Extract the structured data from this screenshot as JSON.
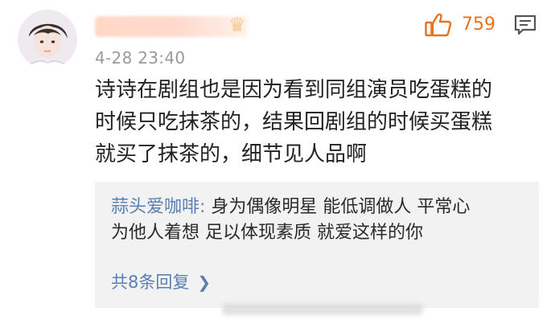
{
  "comment": {
    "timestamp": "4-28 23:40",
    "likes": "759",
    "body_lines": [
      "诗诗在剧组也是因为看到同组演员吃蛋糕的",
      "时候只吃抹茶的，结果回剧组的时候买蛋糕",
      "就买了抹茶的，细节见人品啊"
    ]
  },
  "reply": {
    "username": "蒜头爱咖啡:",
    "text_line1": " 身为偶像明星 能低调做人  平常心",
    "text_line2": "为他人着想  足以体现素质  就爱这样的你",
    "more_replies": "共8条回复"
  },
  "icons": {
    "like": "thumbs-up-icon",
    "comment": "comment-icon",
    "chevron": "chevron-right-icon"
  },
  "colors": {
    "like_orange": "#e8711c",
    "link_blue": "#5a7fb3",
    "timestamp_gray": "#9a9a9a",
    "reply_bg": "#f2f2f2"
  }
}
